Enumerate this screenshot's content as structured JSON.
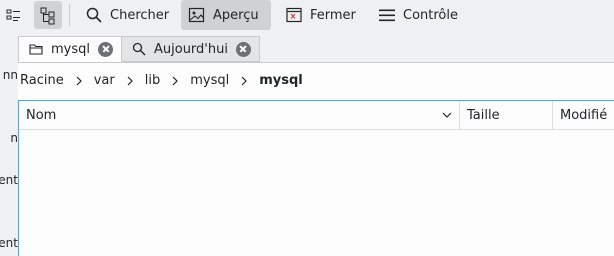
{
  "toolbar": {
    "search_label": "Chercher",
    "preview_label": "Aperçu",
    "close_label": "Fermer",
    "control_label": "Contrôle"
  },
  "tabs": [
    {
      "label": "mysql",
      "icon": "folder-icon",
      "active": true
    },
    {
      "label": "Aujourd'hui",
      "icon": "search-icon",
      "active": false
    }
  ],
  "sidebar_fragments": [
    "nn",
    "n",
    "ent",
    "ent"
  ],
  "breadcrumb": [
    "Racine",
    "var",
    "lib",
    "mysql",
    "mysql"
  ],
  "columns": {
    "name": "Nom",
    "size": "Taille",
    "modified": "Modifié"
  },
  "colors": {
    "accent": "#3daee9",
    "toolbar_active": "#cfd1d3",
    "close_icon_red": "#da4453"
  }
}
